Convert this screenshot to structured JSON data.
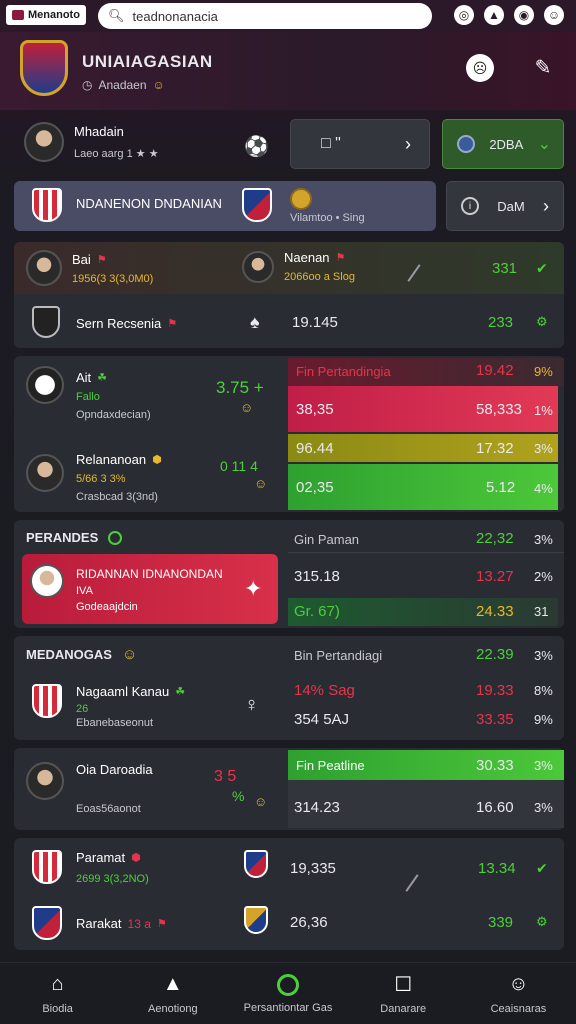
{
  "topbar": {
    "app_name": "Menanoto",
    "search_value": "teadnonanacia",
    "icons": [
      "target-icon",
      "soccer-shirt-icon",
      "notification-icon",
      "profile-icon"
    ]
  },
  "header": {
    "title": "UNIAIAGASIAN",
    "subtitle": "Anadaen"
  },
  "player_row": {
    "name": "Mhadain",
    "meta": "Laeo aarg 1 ★ ★",
    "btn1_text": "□ \"",
    "btn2_text": "2DBA"
  },
  "match_banner": {
    "title": "NDANENON DNDANIAN",
    "sub": "Vilamtoo • Sing",
    "btn_text": "DaM"
  },
  "matches_a": [
    {
      "home": "Bai",
      "home_sub": "1956(3 3(3,0M0)",
      "away": "Naenan",
      "away_sub": "2066oo a Slog",
      "value": "331"
    },
    {
      "home": "Sern Recsenia",
      "home_sub": "",
      "away": "",
      "away_sub": "19.145",
      "value": "233"
    }
  ],
  "stats_block": {
    "header": "Fin Pertandingia",
    "team1": {
      "name": "Ait",
      "sub": "Fallo",
      "sub2": "Opndaxdecian)",
      "score": "3.75 +"
    },
    "team2": {
      "name": "Relananoan",
      "sub": "5/66 3 3%",
      "sub2": "Crasbcad 3(3nd)",
      "score": "0 11 4"
    },
    "rows": [
      {
        "left": "Fin Pertandingia",
        "right": "19.42",
        "pct": "9%"
      },
      {
        "left": "38,35",
        "right": "58,333",
        "pct": "1%"
      },
      {
        "left": "96.44",
        "right": "17.32",
        "pct": "3%"
      },
      {
        "left": "02,35",
        "right": "5.12",
        "pct": "4%"
      }
    ]
  },
  "section_perandes": {
    "title": "PERANDES",
    "highlight_name": "RIDANNAN IDNANONDAN",
    "highlight_sub": "IVA",
    "highlight_sub2": "Godeaajdcin",
    "rows": [
      {
        "left": "Gin Paman",
        "right": "22,32",
        "pct": "3%"
      },
      {
        "left": "315.18",
        "right": "13.27",
        "pct": "2%"
      },
      {
        "left": "Gr. 67)",
        "right": "24.33",
        "pct": "31"
      }
    ]
  },
  "section_medangas": {
    "title": "MEDANOGAS",
    "team_name": "Nagaaml Kanau",
    "team_sub": "26",
    "team_sub2": "Ebanebaseonut",
    "rows": [
      {
        "left": "Bin Pertandiagi",
        "right": "22.39",
        "pct": "3%"
      },
      {
        "left": "14% Sag",
        "right": "19.33",
        "pct": "8%"
      },
      {
        "left": "354 5AJ",
        "right": "33.35",
        "pct": "9%"
      }
    ]
  },
  "section_four": {
    "team_name": "Oia Daroadia",
    "team_sub": "Eoas56aonot",
    "score": "3 5",
    "rows": [
      {
        "left": "Fin Peatline",
        "right": "30.33",
        "pct": "3%"
      },
      {
        "left": "314.23",
        "right": "16.60",
        "pct": "3%"
      }
    ]
  },
  "matches_b": [
    {
      "home": "Paramat",
      "home_sub": "2699 3(3,2NO)",
      "value_mid": "19,335",
      "value": "13.34"
    },
    {
      "home": "Rarakat",
      "home_sub": "13 a",
      "value_mid": "26,36",
      "value": "339"
    }
  ],
  "bottomnav": [
    {
      "label": "Biodia",
      "icon": "home-icon"
    },
    {
      "label": "Aenotiong",
      "icon": "house-icon"
    },
    {
      "label": "Persantiontar Gas",
      "icon": "live-icon"
    },
    {
      "label": "Danarare",
      "icon": "stats-icon"
    },
    {
      "label": "Ceaisnaras",
      "icon": "profile-icon"
    }
  ],
  "colors": {
    "accent_green": "#4cd03a",
    "accent_red": "#e8344a",
    "gold": "#e6b82a"
  }
}
